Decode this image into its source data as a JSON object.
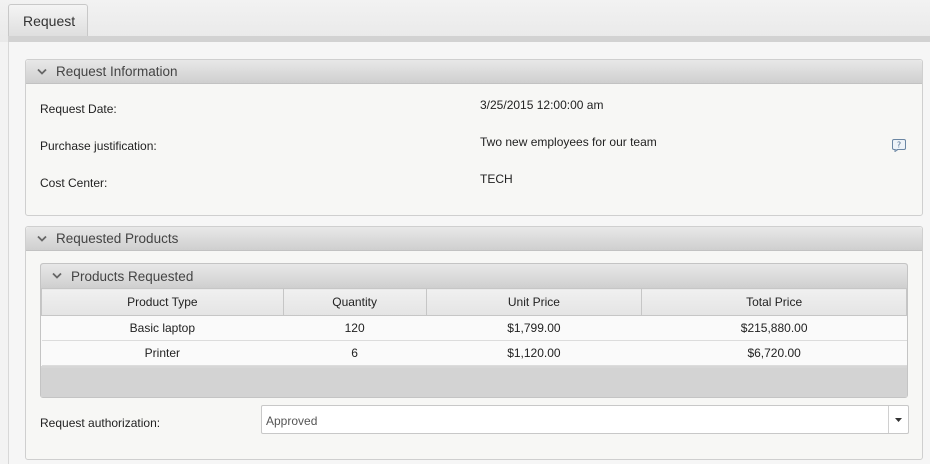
{
  "tabs": [
    {
      "label": "Request"
    }
  ],
  "request_info": {
    "title": "Request Information",
    "fields": [
      {
        "label": "Request Date:",
        "value": "3/25/2015 12:00:00 am"
      },
      {
        "label": "Purchase justification:",
        "value": "Two new employees for our team"
      },
      {
        "label": "Cost Center:",
        "value": "TECH"
      }
    ]
  },
  "requested_products": {
    "title": "Requested Products",
    "products_panel": {
      "title": "Products Requested",
      "columns": [
        "Product Type",
        "Quantity",
        "Unit Price",
        "Total Price"
      ],
      "rows": [
        [
          "Basic laptop",
          "120",
          "$1,799.00",
          "$215,880.00"
        ],
        [
          "Printer",
          "6",
          "$1,120.00",
          "$6,720.00"
        ]
      ]
    },
    "authorization": {
      "label": "Request authorization:",
      "value": "Approved"
    }
  },
  "icons": {
    "collapse": "chevron-down-icon",
    "help": "help-icon",
    "dropdown": "caret-down-icon"
  }
}
